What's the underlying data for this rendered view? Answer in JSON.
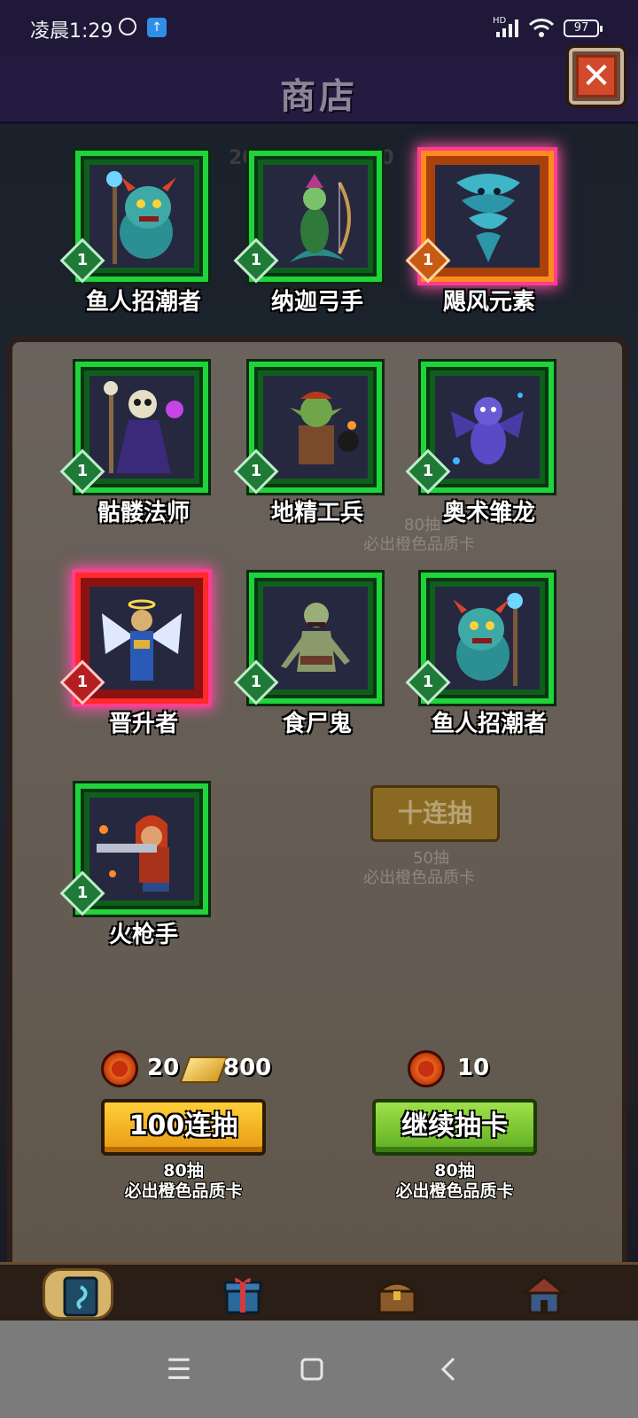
{
  "status_bar": {
    "time": "凌晨1:29",
    "network": "HD",
    "battery": "97"
  },
  "header": {
    "title": "商店"
  },
  "background": {
    "top_counts": [
      "2",
      "20",
      "50"
    ],
    "ghost_button": "十连抽",
    "ghost_notes": [
      "80抽",
      "必出橙色品质卡",
      "50抽",
      "必出橙色品质卡"
    ]
  },
  "cards": [
    {
      "name": "鱼人招潮者",
      "level": "1",
      "rarity": "green",
      "icon": "murloc-tidecaller-icon"
    },
    {
      "name": "纳迦弓手",
      "level": "1",
      "rarity": "green",
      "icon": "naga-archer-icon"
    },
    {
      "name": "飓风元素",
      "level": "1",
      "rarity": "orange",
      "icon": "cyclone-elemental-icon"
    },
    {
      "name": "骷髅法师",
      "level": "1",
      "rarity": "green",
      "icon": "skeleton-mage-icon"
    },
    {
      "name": "地精工兵",
      "level": "1",
      "rarity": "green",
      "icon": "goblin-sapper-icon"
    },
    {
      "name": "奥术雏龙",
      "level": "1",
      "rarity": "green",
      "icon": "arcane-whelp-icon"
    },
    {
      "name": "晋升者",
      "level": "1",
      "rarity": "red",
      "icon": "ascendant-icon"
    },
    {
      "name": "食尸鬼",
      "level": "1",
      "rarity": "green",
      "icon": "ghoul-icon"
    },
    {
      "name": "鱼人招潮者",
      "level": "1",
      "rarity": "green",
      "icon": "murloc-tidecaller-icon"
    },
    {
      "name": "火枪手",
      "level": "1",
      "rarity": "green",
      "icon": "rifleman-icon"
    }
  ],
  "draw": {
    "left": {
      "token_cost": "20",
      "gold_cost": "800",
      "button": "100连抽",
      "note_line1": "80抽",
      "note_line2": "必出橙色品质卡"
    },
    "right": {
      "token_cost": "10",
      "button": "继续抽卡",
      "note_line1": "80抽",
      "note_line2": "必出橙色品质卡"
    }
  },
  "tabs": [
    {
      "icon": "card-pack-icon",
      "active": true
    },
    {
      "icon": "gift-box-icon",
      "active": false
    },
    {
      "icon": "treasure-chest-icon",
      "active": false
    },
    {
      "icon": "tavern-house-icon",
      "active": false
    }
  ],
  "colors": {
    "green_frame": "#1fd33b",
    "orange_frame": "#ff8a1e",
    "red_frame": "#ff2a2a",
    "glow": "#ff4fa6"
  }
}
